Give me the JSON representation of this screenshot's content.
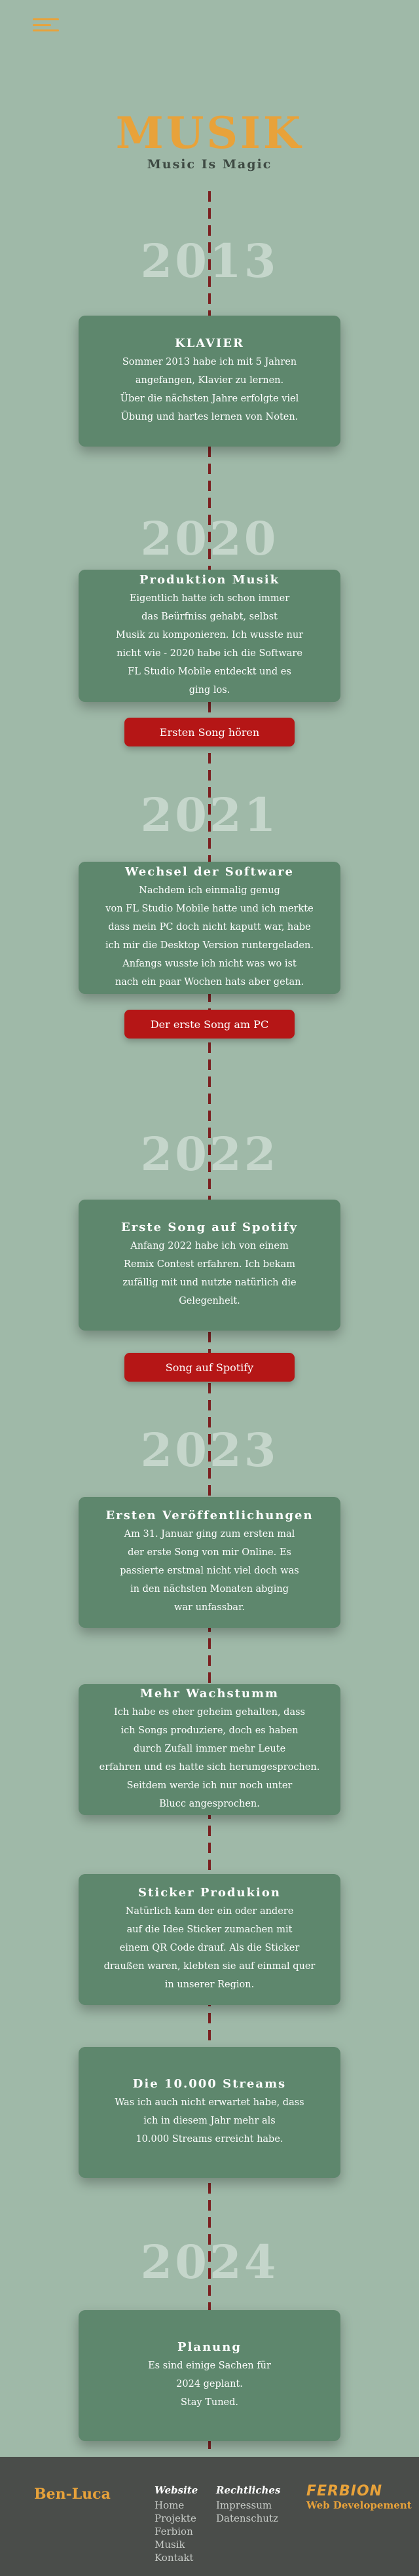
{
  "header": {
    "title": "MUSIK",
    "subtitle": "Music Is Magic"
  },
  "timeline": {
    "years": [
      "2013",
      "2020",
      "2021",
      "2022",
      "2023",
      "2024"
    ],
    "cards": [
      {
        "title": "KLAVIER",
        "text": "Sommer 2013 habe ich mit 5 Jahren\nangefangen, Klavier zu lernen.\nÜber die nächsten Jahre erfolgte viel\nÜbung und hartes lernen von Noten."
      },
      {
        "title": "Produktion Musik",
        "text": "Eigentlich hatte ich schon immer\ndas Beürfniss gehabt, selbst\nMusik zu komponieren. Ich wusste nur\nnicht wie - 2020 habe ich die Software\nFL Studio Mobile entdeckt und es\nging los."
      },
      {
        "title": "Wechsel der Software",
        "text": "Nachdem ich einmalig genug\nvon FL Studio Mobile hatte und ich merkte\ndass mein PC doch nicht kaputt war, habe\nich mir die Desktop Version runtergeladen.\nAnfangs wusste ich nicht was wo ist\nnach ein paar Wochen hats aber getan."
      },
      {
        "title": "Erste Song auf Spotify",
        "text": "Anfang 2022 habe ich von einem\nRemix Contest erfahren. Ich bekam\nzufällig mit und nutzte natürlich die\nGelegenheit."
      },
      {
        "title": "Ersten Veröffentlichungen",
        "text": "Am 31. Januar ging zum ersten mal\nder erste Song von mir Online. Es\npassierte erstmal nicht viel doch was\nin den nächsten Monaten abging\nwar unfassbar."
      },
      {
        "title": "Mehr Wachstumm",
        "text": "Ich habe es eher geheim gehalten, dass\nich Songs produziere, doch es haben\ndurch Zufall immer mehr Leute\nerfahren und es hatte sich herumgesprochen.\nSeitdem werde ich nur noch unter\nBlucc angesprochen."
      },
      {
        "title": "Sticker Produkion",
        "text": "Natürlich kam der ein oder andere\nauf die Idee Sticker zumachen mit\neinem QR Code drauf. Als die Sticker\ndraußen waren, klebten sie auf einmal quer\nin unserer Region."
      },
      {
        "title": "Die 10.000 Streams",
        "text": "Was ich auch nicht erwartet habe, dass\nich in diesem Jahr mehr als\n10.000 Streams erreicht habe."
      },
      {
        "title": "Planung",
        "text": "Es sind einige Sachen für\n2024 geplant.\nStay Tuned."
      }
    ],
    "buttons": [
      "Ersten Song hören",
      "Der erste Song am PC",
      "Song auf Spotify"
    ]
  },
  "footer": {
    "brand": "Ben-Luca",
    "website_heading": "Website",
    "website_links": [
      "Home",
      "Projekte",
      "Ferbion",
      "Musik",
      "Kontakt"
    ],
    "legal_heading": "Rechtliches",
    "legal_links": [
      "Impressum",
      "Datenschutz"
    ],
    "logo_text": "FERBION",
    "logo_caption": "Web Developement"
  },
  "colors": {
    "background": "#9fb9a8",
    "accent": "#e8a23a",
    "card": "#5e876d",
    "button": "#b51616",
    "timeline": "#7a1f1f",
    "footer": "#4a4d4a"
  }
}
